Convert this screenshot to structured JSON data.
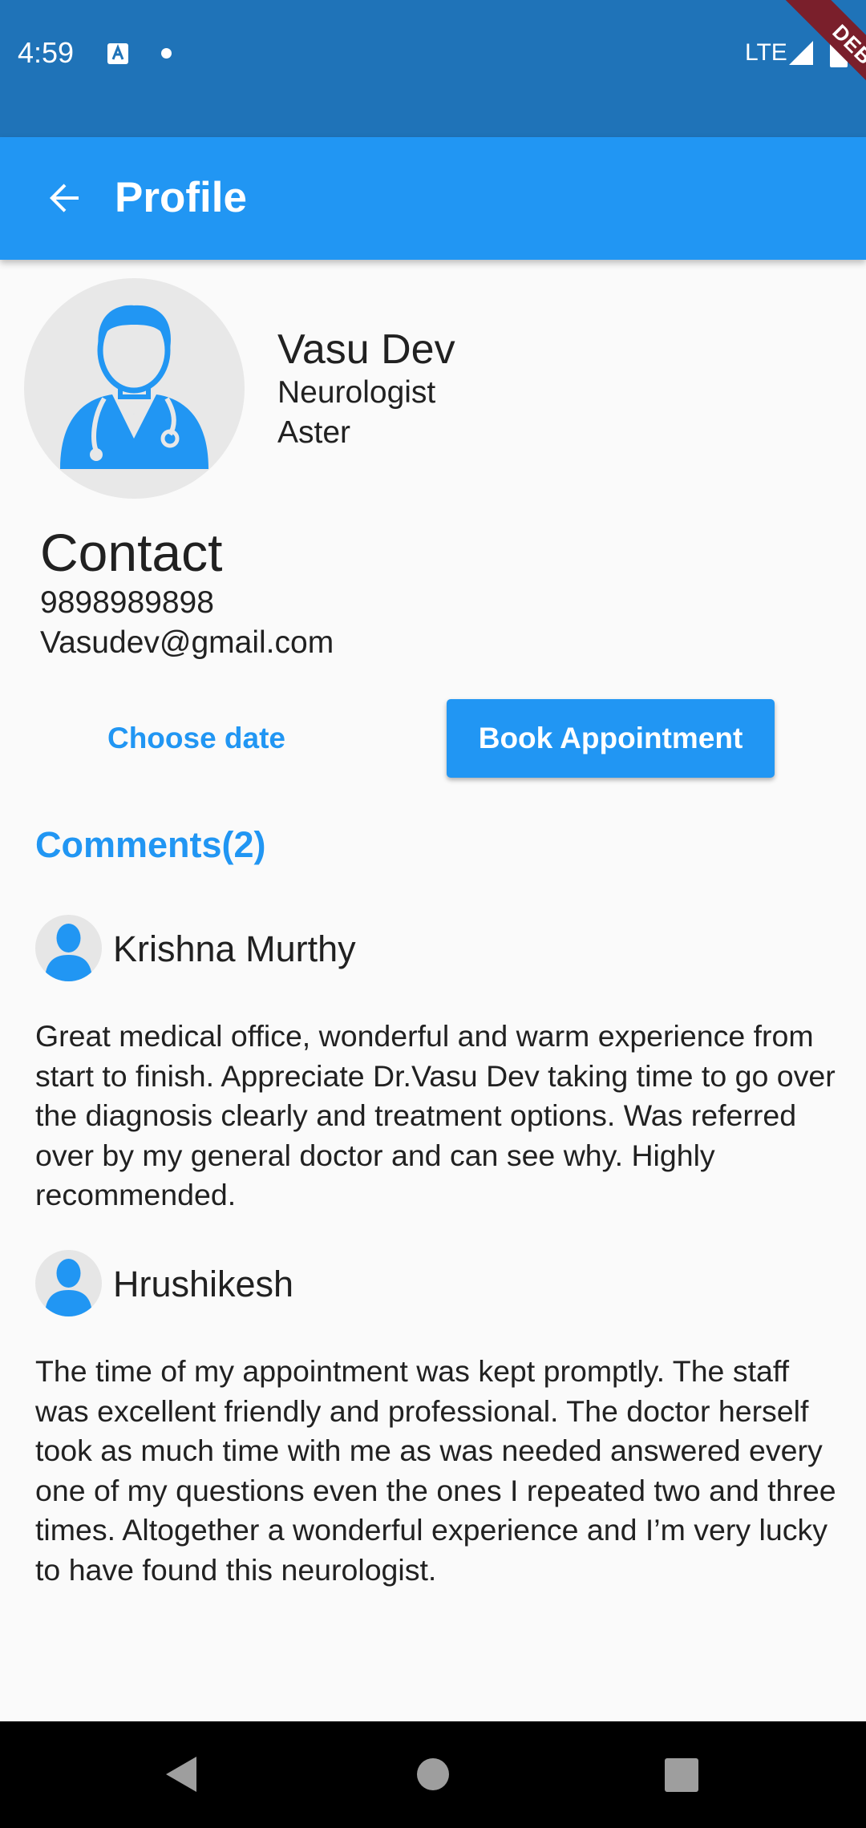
{
  "status_bar": {
    "time": "4:59",
    "network": "LTE",
    "debug_label": "DEBUG"
  },
  "app_bar": {
    "title": "Profile"
  },
  "doctor": {
    "name": "Vasu Dev",
    "specialty": "Neurologist",
    "hospital": "Aster"
  },
  "contact": {
    "heading": "Contact",
    "phone": "9898989898",
    "email": "Vasudev@gmail.com"
  },
  "actions": {
    "choose_date_label": "Choose date",
    "book_label": "Book Appointment"
  },
  "comments": {
    "heading": "Comments(2)",
    "items": [
      {
        "author": "Krishna Murthy",
        "text": "Great medical office, wonderful and warm experience from start to finish. Appreciate Dr.Vasu Dev taking time to go over the diagnosis clearly and treatment options. Was referred over by my general doctor and can see why. Highly recommended."
      },
      {
        "author": "Hrushikesh",
        "text": "The time of my appointment was kept promptly. The staff was excellent friendly and professional. The doctor herself took as much time with me as was needed answered every one of my questions even the ones I repeated two and three times. Altogether a wonderful experience and I’m very lucky to have found this neurologist."
      }
    ]
  },
  "colors": {
    "primary": "#2196f3",
    "status_bar": "#1f73b8",
    "background": "#fafafa",
    "debug_banner": "#7a1f2b"
  }
}
